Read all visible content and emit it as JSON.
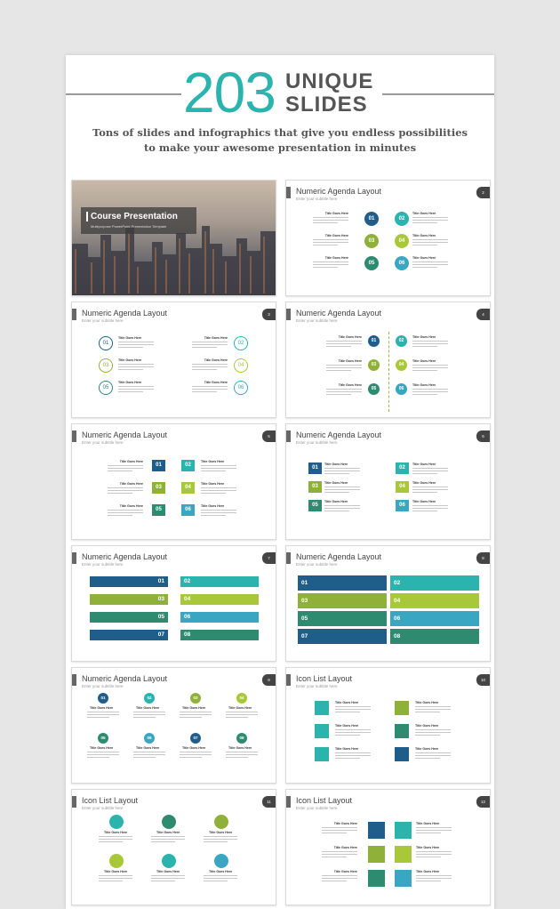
{
  "header": {
    "number": "203",
    "word1": "UNIQUE",
    "word2": "SLIDES",
    "subtitle_line1": "Tons of slides and infographics that give you endless possibilities",
    "subtitle_line2": "to make your awesome presentation in minutes"
  },
  "course": {
    "title": "Course Presentation",
    "subtitle": "Multipurpose PowerPoint Presentation Template"
  },
  "common": {
    "subtitle": "Enter your subtitle here",
    "item_title": "Title Goes Here"
  },
  "slides": [
    {
      "title": "Course Presentation",
      "page": ""
    },
    {
      "title": "Numeric Agenda Layout",
      "page": "2"
    },
    {
      "title": "Numeric Agenda Layout",
      "page": "3"
    },
    {
      "title": "Numeric Agenda Layout",
      "page": "4"
    },
    {
      "title": "Numeric Agenda Layout",
      "page": "5"
    },
    {
      "title": "Numeric Agenda Layout",
      "page": "6"
    },
    {
      "title": "Numeric Agenda Layout",
      "page": "7"
    },
    {
      "title": "Numeric Agenda Layout",
      "page": "8"
    },
    {
      "title": "Numeric Agenda Layout",
      "page": "9"
    },
    {
      "title": "Icon List Layout",
      "page": "10"
    },
    {
      "title": "Icon List Layout",
      "page": "11"
    },
    {
      "title": "Icon List Layout",
      "page": "12"
    }
  ],
  "nums": [
    "01",
    "02",
    "03",
    "04",
    "05",
    "06",
    "07",
    "08"
  ],
  "colors": {
    "teal": "#2bb3ad",
    "navy": "#1f5e8a",
    "green": "#2e8b6f",
    "lime": "#a8c83a",
    "cyan": "#3aa6c2",
    "olive": "#8fb13a",
    "title_bg": "#666666"
  },
  "icons": [
    "cart-icon",
    "chart-icon",
    "doc-icon",
    "hierarchy-icon",
    "card-icon",
    "target-icon"
  ]
}
